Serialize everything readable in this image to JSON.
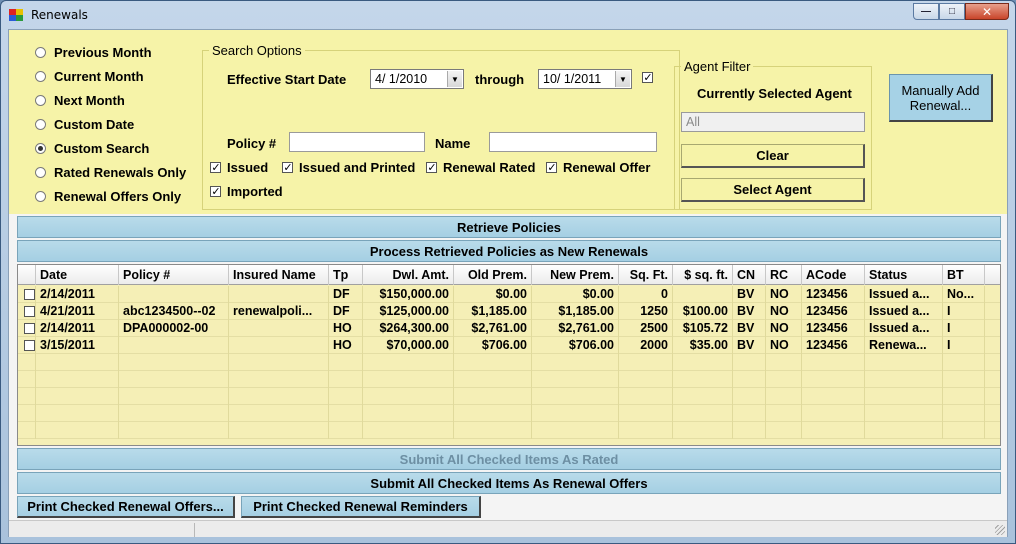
{
  "window": {
    "title": "Renewals"
  },
  "date_options": [
    {
      "label": "Previous Month",
      "selected": false
    },
    {
      "label": "Current Month",
      "selected": false
    },
    {
      "label": "Next Month",
      "selected": false
    },
    {
      "label": "Custom Date",
      "selected": false
    },
    {
      "label": "Custom Search",
      "selected": true
    },
    {
      "label": "Rated Renewals Only",
      "selected": false
    },
    {
      "label": "Renewal Offers Only",
      "selected": false
    }
  ],
  "search": {
    "legend": "Search Options",
    "start_label": "Effective Start Date",
    "start_value": "4/  1/2010",
    "through_label": "through",
    "end_value": "10/  1/2011",
    "end_checked": true,
    "policy_label": "Policy #",
    "policy_value": "",
    "name_label": "Name",
    "name_value": "",
    "filters": [
      {
        "label": "Issued",
        "checked": true
      },
      {
        "label": "Issued and Printed",
        "checked": true
      },
      {
        "label": "Renewal Rated",
        "checked": true
      },
      {
        "label": "Renewal Offer",
        "checked": true
      },
      {
        "label": "Imported",
        "checked": true
      }
    ]
  },
  "agent": {
    "legend": "Agent Filter",
    "caption": "Currently Selected Agent",
    "value": "All",
    "clear_label": "Clear",
    "select_label": "Select Agent"
  },
  "manual_add_label": "Manually Add\nRenewal...",
  "retrieve_label": "Retrieve Policies",
  "process_label": "Process Retrieved Policies as New Renewals",
  "grid": {
    "columns": [
      "Date",
      "Policy #",
      "Insured Name",
      "Tp",
      "Dwl. Amt.",
      "Old Prem.",
      "New Prem.",
      "Sq. Ft.",
      "$ sq. ft.",
      "CN",
      "RC",
      "ACode",
      "Status",
      "BT"
    ],
    "rows": [
      [
        "2/14/2011",
        "",
        "",
        "DF",
        "$150,000.00",
        "$0.00",
        "$0.00",
        "0",
        "",
        "BV",
        "NO",
        "123456",
        "Issued a...",
        "No..."
      ],
      [
        "4/21/2011",
        "abc1234500--02",
        "renewalpoli...",
        "DF",
        "$125,000.00",
        "$1,185.00",
        "$1,185.00",
        "1250",
        "$100.00",
        "BV",
        "NO",
        "123456",
        "Issued a...",
        "I"
      ],
      [
        "2/14/2011",
        "DPA000002-00",
        "",
        "HO",
        "$264,300.00",
        "$2,761.00",
        "$2,761.00",
        "2500",
        "$105.72",
        "BV",
        "NO",
        "123456",
        "Issued a...",
        "I"
      ],
      [
        "3/15/2011",
        "",
        "",
        "HO",
        "$70,000.00",
        "$706.00",
        "$706.00",
        "2000",
        "$35.00",
        "BV",
        "NO",
        "123456",
        "Renewa...",
        "I"
      ]
    ]
  },
  "submit_rated_label": "Submit All Checked Items As Rated",
  "submit_offers_label": "Submit All Checked Items As Renewal Offers",
  "print_offers_label": "Print Checked Renewal Offers...",
  "print_reminders_label": "Print Checked Renewal Reminders"
}
